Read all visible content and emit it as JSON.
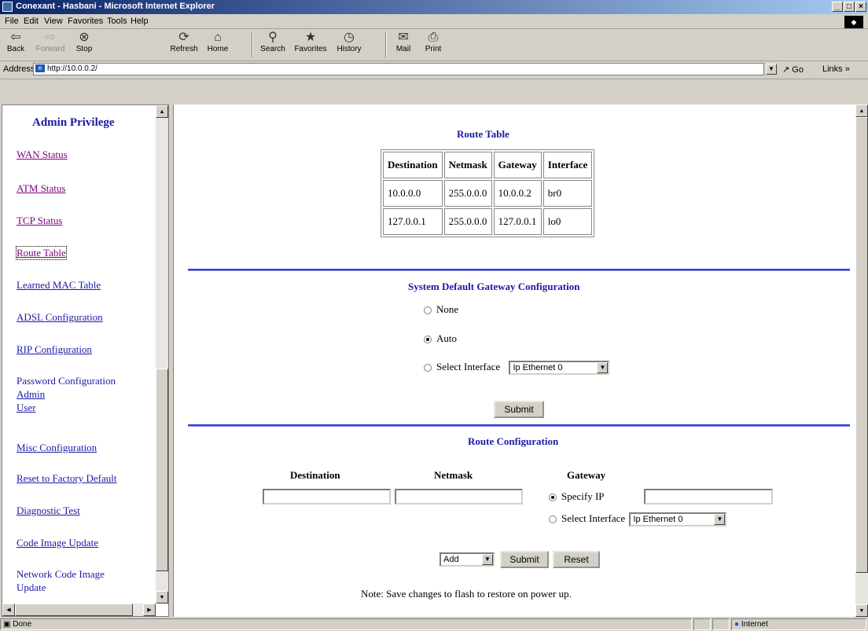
{
  "window": {
    "title": "Conexant - Hasbani - Microsoft Internet Explorer"
  },
  "menu": [
    "File",
    "Edit",
    "View",
    "Favorites",
    "Tools",
    "Help"
  ],
  "toolbar": [
    {
      "label": "Back",
      "icon": "back-arrow-icon",
      "glyph": "⇦"
    },
    {
      "label": "Forward",
      "icon": "forward-arrow-icon",
      "glyph": "⇨"
    },
    {
      "label": "Stop",
      "icon": "stop-icon",
      "glyph": "⊗"
    },
    {
      "label": "Refresh",
      "icon": "refresh-icon",
      "glyph": "⟳"
    },
    {
      "label": "Home",
      "icon": "home-icon",
      "glyph": "⌂"
    },
    {
      "label": "Search",
      "icon": "search-icon",
      "glyph": "⚲"
    },
    {
      "label": "Favorites",
      "icon": "favorites-icon",
      "glyph": "★"
    },
    {
      "label": "History",
      "icon": "history-icon",
      "glyph": "◷"
    },
    {
      "label": "Mail",
      "icon": "mail-icon",
      "glyph": "✉"
    },
    {
      "label": "Print",
      "icon": "print-icon",
      "glyph": "⎙"
    }
  ],
  "address": {
    "label": "Address",
    "url": "http://10.0.0.2/",
    "go": "Go",
    "links": "Links"
  },
  "sidebar": {
    "heading": "Admin Privilege",
    "items": [
      {
        "label": "WAN Status"
      },
      {
        "label": "ATM Status"
      },
      {
        "label": "TCP Status"
      },
      {
        "label": "Route Table"
      },
      {
        "label": "Learned MAC Table"
      },
      {
        "label": "ADSL Configuration"
      },
      {
        "label": "RIP Configuration"
      },
      {
        "label": "Password Configuration"
      },
      {
        "label": "Admin"
      },
      {
        "label": "User"
      },
      {
        "label": "Misc Configuration"
      },
      {
        "label": "Reset to Factory Default"
      },
      {
        "label": "Diagnostic Test"
      },
      {
        "label": "Code Image Update"
      },
      {
        "label": "Network Code Image"
      },
      {
        "label": "Update"
      }
    ]
  },
  "route_table": {
    "title": "Route Table",
    "headers": [
      "Destination",
      "Netmask",
      "Gateway",
      "Interface"
    ],
    "rows": [
      [
        "10.0.0.0",
        "255.0.0.0",
        "10.0.0.2",
        "br0"
      ],
      [
        "127.0.0.1",
        "255.0.0.0",
        "127.0.0.1",
        "lo0"
      ]
    ]
  },
  "default_gateway": {
    "title": "System Default Gateway Configuration",
    "options": [
      "None",
      "Auto",
      "Select Interface"
    ],
    "selected": "Auto",
    "interface_value": "Ip Ethernet 0",
    "submit": "Submit"
  },
  "route_config": {
    "title": "Route Configuration",
    "col_destination": "Destination",
    "col_netmask": "Netmask",
    "col_gateway": "Gateway",
    "specify_ip": "Specify IP",
    "select_interface": "Select Interface",
    "interface_value": "Ip Ethernet 0",
    "action_value": "Add",
    "submit": "Submit",
    "reset": "Reset",
    "note": "Note: Save changes to flash to restore on power up."
  },
  "status": {
    "text": "Done",
    "zone": "Internet"
  }
}
